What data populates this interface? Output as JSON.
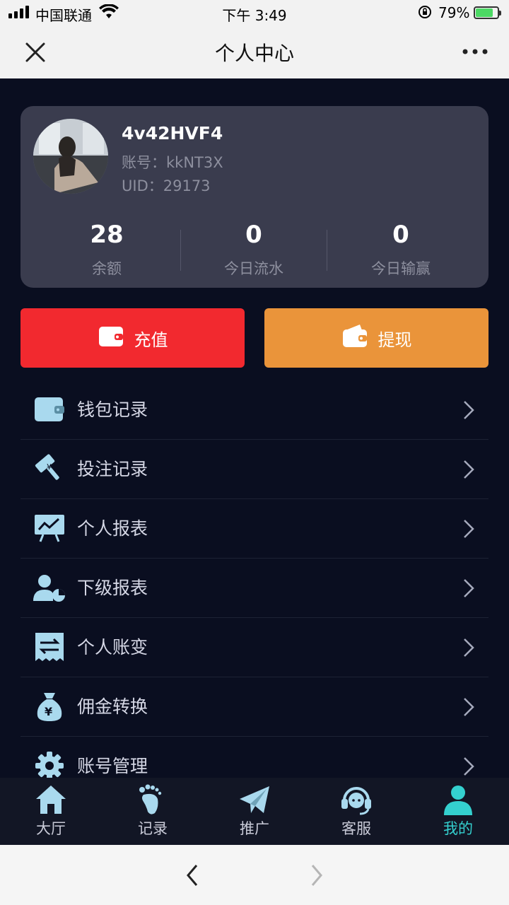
{
  "status": {
    "carrier": "中国联通",
    "time": "下午 3:49",
    "battery": "79%",
    "battery_level": 0.79
  },
  "nav": {
    "title": "个人中心"
  },
  "profile": {
    "username": "4v42HVF4",
    "account": "账号：kkNT3X",
    "uid": "UID：29173",
    "stats": [
      {
        "value": "28",
        "label": "余额"
      },
      {
        "value": "0",
        "label": "今日流水"
      },
      {
        "value": "0",
        "label": "今日输赢"
      }
    ]
  },
  "actions": {
    "recharge": "充值",
    "withdraw": "提现"
  },
  "menu": [
    {
      "label": "钱包记录",
      "icon": "wallet-icon"
    },
    {
      "label": "投注记录",
      "icon": "gavel-icon"
    },
    {
      "label": "个人报表",
      "icon": "chart-board-icon"
    },
    {
      "label": "下级报表",
      "icon": "user-pie-icon"
    },
    {
      "label": "个人账变",
      "icon": "receipt-transfer-icon"
    },
    {
      "label": "佣金转换",
      "icon": "money-bag-icon"
    },
    {
      "label": "账号管理",
      "icon": "gear-icon"
    }
  ],
  "tabs": [
    {
      "label": "大厅",
      "icon": "home-icon"
    },
    {
      "label": "记录",
      "icon": "footprint-icon"
    },
    {
      "label": "推广",
      "icon": "paper-plane-icon"
    },
    {
      "label": "客服",
      "icon": "headset-icon"
    },
    {
      "label": "我的",
      "icon": "user-icon"
    }
  ],
  "colors": {
    "accent": "#34d0cf",
    "recharge": "#f2292f",
    "withdraw": "#ea943a",
    "icon": "#a9d9ee"
  }
}
